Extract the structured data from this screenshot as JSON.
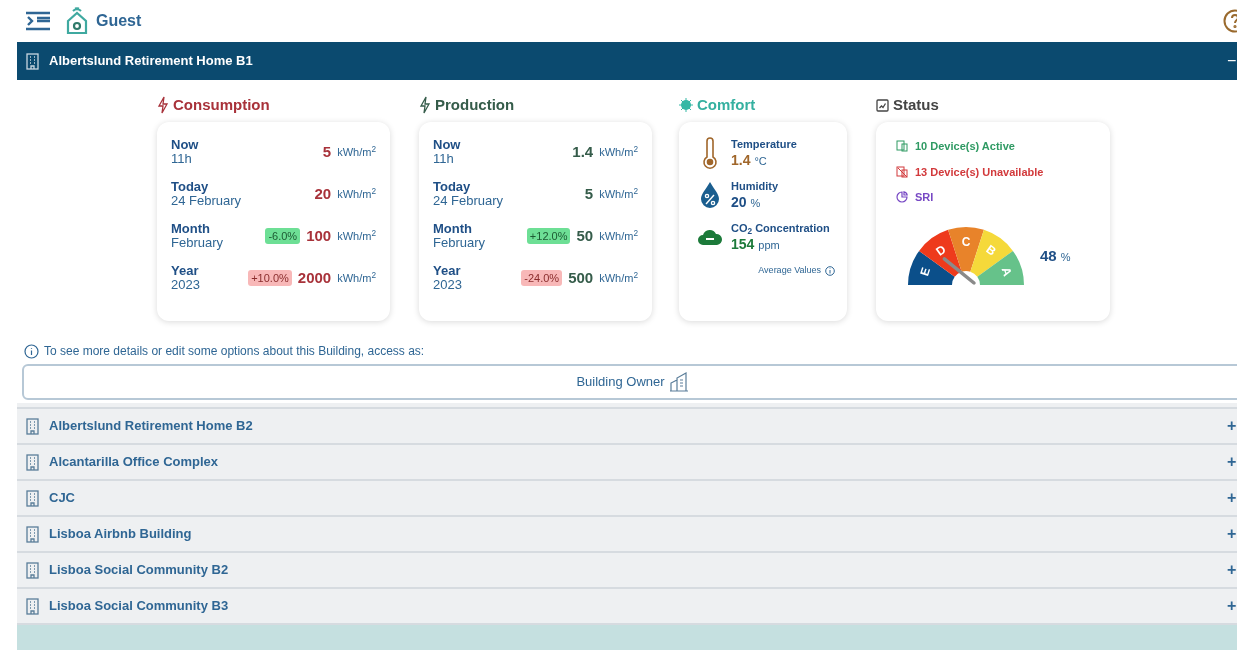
{
  "header": {
    "title": "Guest"
  },
  "active_building": {
    "name": "Albertslund Retirement Home B1",
    "expanded": true,
    "toggle": "−"
  },
  "energy_cards": [
    {
      "kind": "consumption",
      "title": "Consumption",
      "rows": [
        {
          "label": "Now",
          "sub": "11h",
          "value": "5",
          "unit": "kWh/m$^{2}$"
        },
        {
          "label": "Today",
          "sub": "24 February",
          "value": "20",
          "unit": "kWh/m$^{2}$"
        },
        {
          "label": "Month",
          "sub": "February",
          "badge": {
            "text": "-6.0%",
            "favorable": true
          },
          "value": "100",
          "unit": "kWh/m$^{2}$"
        },
        {
          "label": "Year",
          "sub": "2023",
          "badge": {
            "text": "+10.0%",
            "favorable": false
          },
          "value": "2000",
          "unit": "kWh/m$^{2}$"
        }
      ]
    },
    {
      "kind": "production",
      "title": "Production",
      "rows": [
        {
          "label": "Now",
          "sub": "11h",
          "value": "1.4",
          "unit": "kWh/m$^{2}$"
        },
        {
          "label": "Today",
          "sub": "24 February",
          "value": "5",
          "unit": "kWh/m$^{2}$"
        },
        {
          "label": "Month",
          "sub": "February",
          "badge": {
            "text": "+12.0%",
            "favorable": true
          },
          "value": "50",
          "unit": "kWh/m$^{2}$"
        },
        {
          "label": "Year",
          "sub": "2023",
          "badge": {
            "text": "-24.0%",
            "favorable": false
          },
          "value": "500",
          "unit": "kWh/m$^{2}$"
        }
      ]
    }
  ],
  "comfort": {
    "title": "Comfort",
    "items": [
      {
        "kind": "temperature",
        "label": "Temperature",
        "value": "1.4",
        "unit": "°C"
      },
      {
        "kind": "humidity",
        "label": "Humidity",
        "value": "20",
        "unit": "%"
      },
      {
        "kind": "co2",
        "label": "CO$_{2}$ Concentration",
        "value": "154",
        "unit": "ppm"
      }
    ],
    "footnote": "Average Values"
  },
  "status": {
    "title": "Status",
    "items": [
      {
        "kind": "active",
        "text": "10 Device(s) Active"
      },
      {
        "kind": "unavailable",
        "text": "13 Device(s) Unavailable"
      },
      {
        "kind": "sri",
        "text": "SRI"
      }
    ],
    "gauge": {
      "reading": "48",
      "unit": "%",
      "grades": [
        {
          "letter": "E",
          "color": "#0b4f8a"
        },
        {
          "letter": "D",
          "color": "#ee3a1c"
        },
        {
          "letter": "C",
          "color": "#e8832a"
        },
        {
          "letter": "B",
          "color": "#f5d93a"
        },
        {
          "letter": "A",
          "color": "#66c28a"
        }
      ]
    }
  },
  "access": {
    "info": "To see more details or edit some options about this Building, access as:",
    "button": "Building Owner"
  },
  "buildings": [
    {
      "name": "Albertslund Retirement Home B2",
      "expanded": false,
      "toggle": "+"
    },
    {
      "name": "Alcantarilla Office Complex",
      "expanded": false,
      "toggle": "+"
    },
    {
      "name": "CJC",
      "expanded": false,
      "toggle": "+"
    },
    {
      "name": "Lisboa Airbnb Building",
      "expanded": false,
      "toggle": "+"
    },
    {
      "name": "Lisboa Social Community B2",
      "expanded": false,
      "toggle": "+"
    },
    {
      "name": "Lisboa Social Community B3",
      "expanded": false,
      "toggle": "+"
    }
  ]
}
